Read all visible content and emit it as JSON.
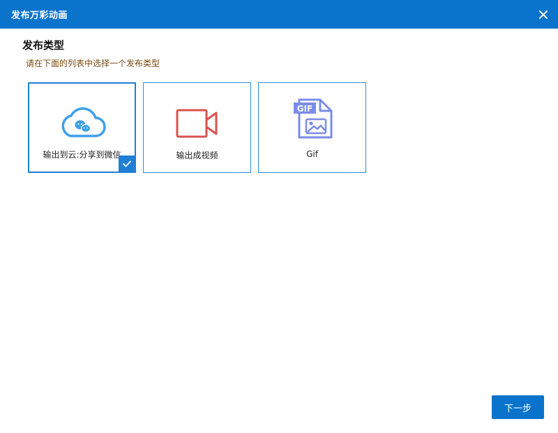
{
  "window": {
    "title": "发布万彩动画"
  },
  "section": {
    "title": "发布类型",
    "hint": "请在下面的列表中选择一个发布类型"
  },
  "options": [
    {
      "label": "输出到云:分享到微信",
      "icon": "cloud-wechat-icon",
      "selected": true,
      "color": "#3d9fe8"
    },
    {
      "label": "输出成视频",
      "icon": "video-camera-icon",
      "selected": false,
      "color": "#d9534f"
    },
    {
      "label": "Gif",
      "icon": "gif-file-icon",
      "selected": false,
      "color": "#7b8ce8"
    }
  ],
  "footer": {
    "next_label": "下一步"
  },
  "colors": {
    "accent": "#0a73cb",
    "hint": "#7a4a12"
  }
}
